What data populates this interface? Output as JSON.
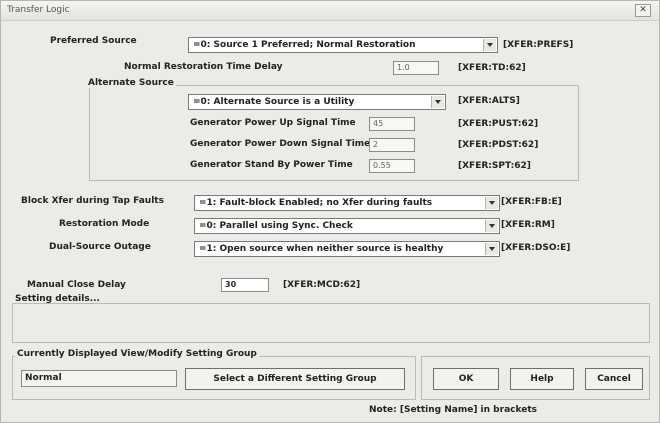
{
  "window": {
    "title": "Transfer Logic",
    "close_label": "✕"
  },
  "preferred_source": {
    "label": "Preferred Source",
    "value": "=0: Source 1 Preferred; Normal Restoration",
    "tag": "[XFER:PREFS]"
  },
  "normal_restoration_delay": {
    "label": "Normal Restoration Time Delay",
    "value": "1.0",
    "tag": "[XFER:TD:62]"
  },
  "alternate_source": {
    "group_title": "Alternate Source",
    "value": "=0: Alternate Source is a Utility",
    "tag": "[XFER:ALTS]",
    "power_up": {
      "label": "Generator Power Up Signal Time",
      "value": "45",
      "tag": "[XFER:PUST:62]"
    },
    "power_down": {
      "label": "Generator Power Down Signal Time",
      "value": "2",
      "tag": "[XFER:PDST:62]"
    },
    "stand_by": {
      "label": "Generator Stand By Power Time",
      "value": "0.55",
      "tag": "[XFER:SPT:62]"
    }
  },
  "block_xfer": {
    "label": "Block Xfer during Tap Faults",
    "value": "=1: Fault-block Enabled; no Xfer during faults",
    "tag": "[XFER:FB:E]"
  },
  "restoration_mode": {
    "label": "Restoration Mode",
    "value": "=0: Parallel using Sync. Check",
    "tag": "[XFER:RM]"
  },
  "dual_source": {
    "label": "Dual-Source Outage",
    "value": "=1: Open source when neither source is healthy",
    "tag": "[XFER:DSO:E]"
  },
  "manual_close": {
    "label": "Manual Close Delay",
    "value": "30",
    "tag": "[XFER:MCD:62]"
  },
  "details": {
    "title": "Setting details..."
  },
  "setting_group": {
    "title": "Currently Displayed View/Modify Setting Group",
    "value": "Normal",
    "select_label": "Select a Different Setting Group"
  },
  "buttons": {
    "ok": "OK",
    "help": "Help",
    "cancel": "Cancel"
  },
  "note": "Note: [Setting Name] in brackets"
}
